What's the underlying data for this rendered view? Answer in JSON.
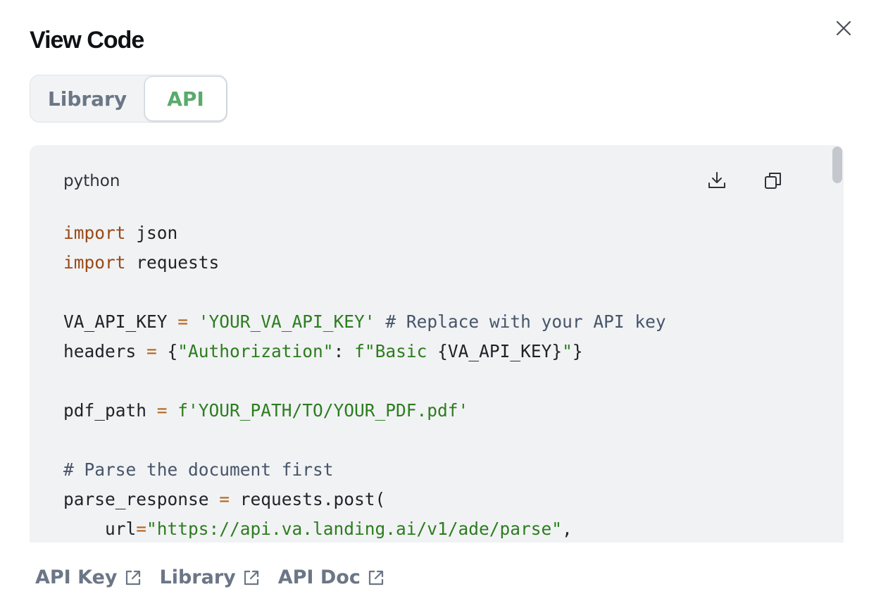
{
  "dialog": {
    "title": "View Code",
    "close_icon": "close-icon"
  },
  "tabs": [
    {
      "label": "Library",
      "active": false
    },
    {
      "label": "API",
      "active": true
    }
  ],
  "code_block": {
    "language": "python",
    "actions": [
      "download-icon",
      "copy-icon"
    ],
    "lines": [
      [
        {
          "t": "kw",
          "v": "import"
        },
        {
          "t": "",
          "v": " json"
        }
      ],
      [
        {
          "t": "kw",
          "v": "import"
        },
        {
          "t": "",
          "v": " requests"
        }
      ],
      [],
      [
        {
          "t": "",
          "v": "VA_API_KEY "
        },
        {
          "t": "op",
          "v": "="
        },
        {
          "t": "",
          "v": " "
        },
        {
          "t": "str",
          "v": "'YOUR_VA_API_KEY'"
        },
        {
          "t": "",
          "v": " "
        },
        {
          "t": "cmt",
          "v": "# Replace with your API key"
        }
      ],
      [
        {
          "t": "",
          "v": "headers "
        },
        {
          "t": "op",
          "v": "="
        },
        {
          "t": "",
          "v": " {"
        },
        {
          "t": "str",
          "v": "\"Authorization\""
        },
        {
          "t": "",
          "v": ": "
        },
        {
          "t": "str",
          "v": "f\"Basic "
        },
        {
          "t": "",
          "v": "{VA_API_KEY}"
        },
        {
          "t": "str",
          "v": "\""
        },
        {
          "t": "",
          "v": "}"
        }
      ],
      [],
      [
        {
          "t": "",
          "v": "pdf_path "
        },
        {
          "t": "op",
          "v": "="
        },
        {
          "t": "",
          "v": " "
        },
        {
          "t": "str",
          "v": "f'YOUR_PATH/TO/YOUR_PDF.pdf'"
        }
      ],
      [],
      [
        {
          "t": "cmt",
          "v": "# Parse the document first"
        }
      ],
      [
        {
          "t": "",
          "v": "parse_response "
        },
        {
          "t": "op",
          "v": "="
        },
        {
          "t": "",
          "v": " requests.post("
        }
      ],
      [
        {
          "t": "",
          "v": "    url"
        },
        {
          "t": "op",
          "v": "="
        },
        {
          "t": "str",
          "v": "\"https://api.va.landing.ai/v1/ade/parse\""
        },
        {
          "t": "",
          "v": ","
        }
      ]
    ]
  },
  "footer": {
    "links": [
      {
        "label": "API Key",
        "icon": "external-link-icon"
      },
      {
        "label": "Library",
        "icon": "external-link-icon"
      },
      {
        "label": "API Doc",
        "icon": "external-link-icon"
      }
    ]
  },
  "colors": {
    "accent_green": "#5aaa6e",
    "keyword": "#9a4a17",
    "string": "#2c7d1f",
    "comment": "#475569",
    "code_background": "#f1f2f4"
  }
}
